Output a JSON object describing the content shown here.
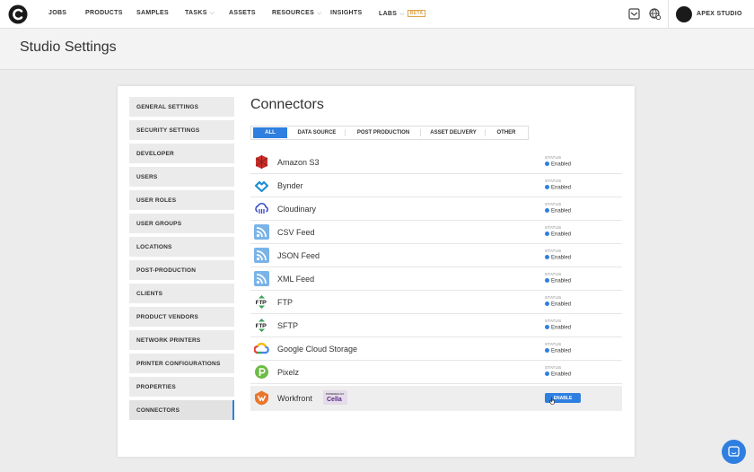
{
  "nav": {
    "items": [
      {
        "label": "JOBS"
      },
      {
        "label": "PRODUCTS"
      },
      {
        "label": "SAMPLES"
      },
      {
        "label": "TASKS"
      },
      {
        "label": "ASSETS"
      },
      {
        "label": "RESOURCES"
      },
      {
        "label": "INSIGHTS"
      },
      {
        "label": "LABS"
      }
    ],
    "beta_badge": "BETA",
    "org_name": "APEX STUDIO"
  },
  "page": {
    "title": "Studio Settings"
  },
  "sidebar": {
    "items": [
      {
        "label": "GENERAL SETTINGS"
      },
      {
        "label": "SECURITY SETTINGS"
      },
      {
        "label": "DEVELOPER"
      },
      {
        "label": "USERS"
      },
      {
        "label": "USER ROLES"
      },
      {
        "label": "USER GROUPS"
      },
      {
        "label": "LOCATIONS"
      },
      {
        "label": "POST-PRODUCTION"
      },
      {
        "label": "CLIENTS"
      },
      {
        "label": "PRODUCT VENDORS"
      },
      {
        "label": "NETWORK PRINTERS"
      },
      {
        "label": "PRINTER CONFIGURATIONS"
      },
      {
        "label": "PROPERTIES"
      },
      {
        "label": "CONNECTORS"
      }
    ],
    "active": "CONNECTORS"
  },
  "connectors": {
    "title": "Connectors",
    "filters": [
      {
        "label": "ALL"
      },
      {
        "label": "DATA SOURCE"
      },
      {
        "label": "POST PRODUCTION"
      },
      {
        "label": "ASSET DELIVERY"
      },
      {
        "label": "OTHER"
      }
    ],
    "active_filter": "ALL",
    "status_label": "STATUS",
    "rows": [
      {
        "name": "Amazon S3",
        "status": "Enabled",
        "icon": "amazon-s3-icon"
      },
      {
        "name": "Bynder",
        "status": "Enabled",
        "icon": "bynder-icon"
      },
      {
        "name": "Cloudinary",
        "status": "Enabled",
        "icon": "cloudinary-icon"
      },
      {
        "name": "CSV Feed",
        "status": "Enabled",
        "icon": "rss-icon"
      },
      {
        "name": "JSON Feed",
        "status": "Enabled",
        "icon": "rss-icon"
      },
      {
        "name": "XML Feed",
        "status": "Enabled",
        "icon": "rss-icon"
      },
      {
        "name": "FTP",
        "status": "Enabled",
        "icon": "ftp-icon"
      },
      {
        "name": "SFTP",
        "status": "Enabled",
        "icon": "ftp-icon"
      },
      {
        "name": "Google Cloud Storage",
        "status": "Enabled",
        "icon": "google-cloud-icon"
      },
      {
        "name": "Pixelz",
        "status": "Enabled",
        "icon": "pixelz-icon"
      },
      {
        "name": "Workfront",
        "status": "",
        "icon": "workfront-icon",
        "action": "ENABLE",
        "powered_by": "POWERED BY",
        "powered_brand": "Cella"
      }
    ]
  },
  "colors": {
    "accent": "#2f7fe0",
    "badge": "#e0a24a"
  }
}
